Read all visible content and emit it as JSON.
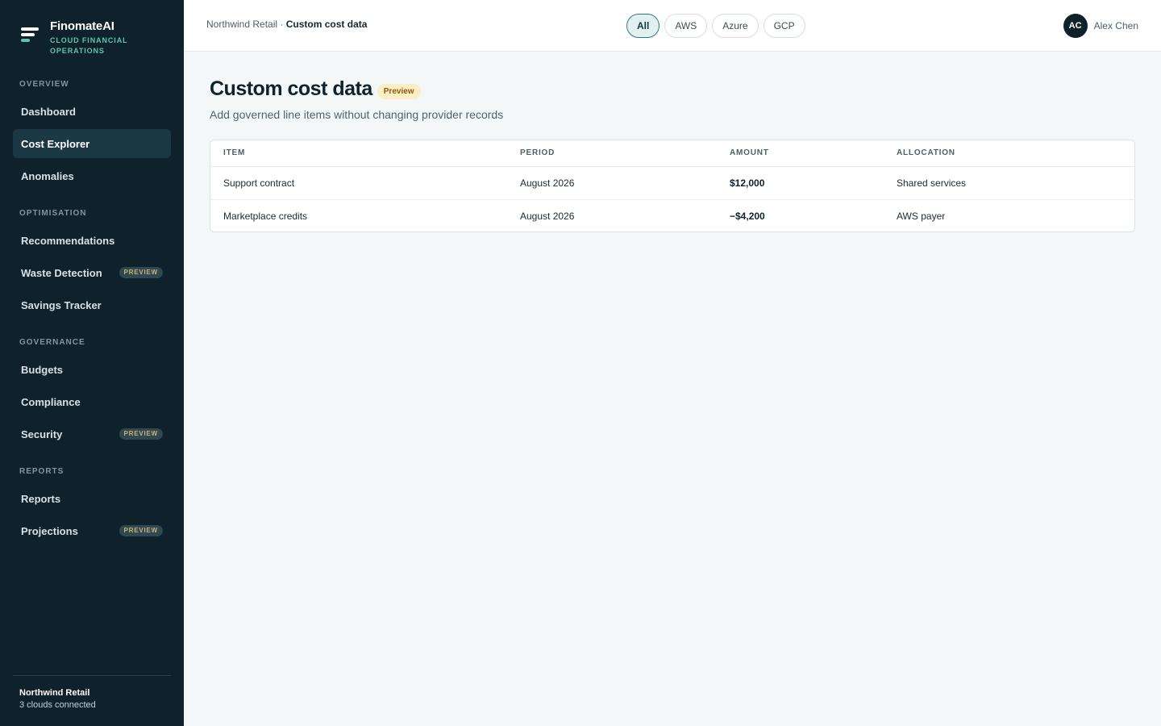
{
  "brand": {
    "name": "FinomateAI",
    "tagline": "CLOUD FINANCIAL OPERATIONS"
  },
  "sidebar": {
    "sections": [
      {
        "label": "OVERVIEW"
      },
      {
        "label": "OPTIMISATION"
      },
      {
        "label": "GOVERNANCE"
      },
      {
        "label": "REPORTS"
      }
    ],
    "items": [
      {
        "label": "Dashboard",
        "active": false
      },
      {
        "label": "Cost Explorer",
        "active": true
      },
      {
        "label": "Anomalies",
        "active": false
      },
      {
        "label": "Recommendations",
        "active": false
      },
      {
        "label": "Waste Detection",
        "badge": "PREVIEW",
        "active": false
      },
      {
        "label": "Savings Tracker",
        "active": false
      },
      {
        "label": "Budgets",
        "active": false
      },
      {
        "label": "Compliance",
        "active": false
      },
      {
        "label": "Security",
        "badge": "PREVIEW",
        "active": false
      },
      {
        "label": "Reports",
        "active": false
      },
      {
        "label": "Projections",
        "badge": "PREVIEW",
        "active": false
      }
    ],
    "footer": {
      "org": "Northwind Retail",
      "status": "3 clouds connected"
    }
  },
  "header": {
    "breadcrumb_parent": "Northwind Retail",
    "breadcrumb_separator": "·",
    "breadcrumb_current": "Custom cost data",
    "filters": [
      {
        "label": "All",
        "active": true
      },
      {
        "label": "AWS",
        "active": false
      },
      {
        "label": "Azure",
        "active": false
      },
      {
        "label": "GCP",
        "active": false
      }
    ],
    "user": {
      "initials": "AC",
      "name": "Alex Chen"
    }
  },
  "page": {
    "title": "Custom cost data",
    "badge": "Preview",
    "subtitle": "Add governed line items without changing provider records"
  },
  "table": {
    "columns": [
      "ITEM",
      "PERIOD",
      "AMOUNT",
      "ALLOCATION"
    ],
    "rows": [
      {
        "item": "Support contract",
        "period": "August 2026",
        "amount": "$12,000",
        "allocation": "Shared services"
      },
      {
        "item": "Marketplace credits",
        "period": "August 2026",
        "amount": "−$4,200",
        "allocation": "AWS payer"
      }
    ]
  },
  "colors": {
    "sidebar_bg": "#0f222b",
    "accent": "#5cc6ad",
    "active_filter_border": "#2e7c78",
    "preview_badge_bg": "#fbeec4"
  }
}
